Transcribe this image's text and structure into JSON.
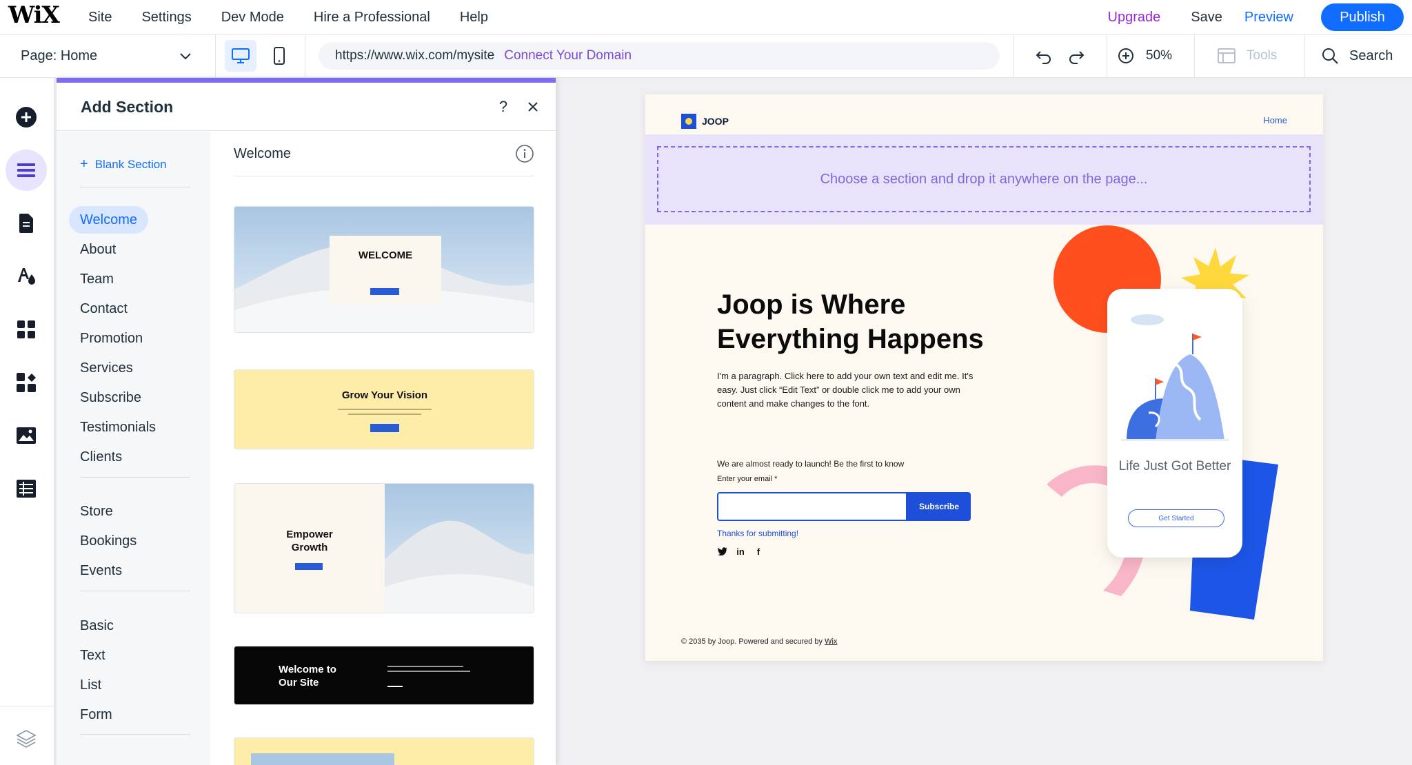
{
  "topbar": {
    "logo": "WiX",
    "menu": [
      "Site",
      "Settings",
      "Dev Mode",
      "Hire a Professional",
      "Help"
    ],
    "upgrade": "Upgrade",
    "save": "Save",
    "preview": "Preview",
    "publish": "Publish"
  },
  "bar2": {
    "page_label": "Page: Home",
    "url": "https://www.wix.com/mysite",
    "connect_domain": "Connect Your Domain",
    "zoom": "50%",
    "tools": "Tools",
    "search": "Search"
  },
  "panel": {
    "title": "Add Section",
    "help": "?",
    "blank_section": "Blank Section",
    "categories_group1": [
      "Welcome",
      "About",
      "Team",
      "Contact",
      "Promotion",
      "Services",
      "Subscribe",
      "Testimonials",
      "Clients"
    ],
    "categories_group2": [
      "Store",
      "Bookings",
      "Events"
    ],
    "categories_group3": [
      "Basic",
      "Text",
      "List",
      "Form"
    ],
    "active_category": "Welcome",
    "templates_title": "Welcome",
    "templates": [
      {
        "heading": "WELCOME"
      },
      {
        "heading": "Grow Your Vision"
      },
      {
        "heading": "Empower Growth"
      },
      {
        "heading": "Welcome to Our Site"
      }
    ]
  },
  "site": {
    "logo": "JOOP",
    "nav_home": "Home",
    "dropzone": "Choose a section and drop it anywhere on the page...",
    "hero_title": "Joop is Where Everything Happens",
    "hero_paragraph": "I'm a paragraph. Click here to add your own text and edit me. It's easy. Just click “Edit Text” or double click me to add your own content and make changes to the font.",
    "launch_text": "We are almost ready to launch! Be the first to know",
    "email_label": "Enter your email *",
    "subscribe": "Subscribe",
    "thanks": "Thanks for submitting!",
    "phone_text": "Life Just Got Better",
    "phone_button": "Get Started",
    "footer": "© 2035 by Joop. Powered and secured by",
    "footer_link": "Wix"
  },
  "colors": {
    "accent": "#116dff",
    "upgrade": "#9a27d5",
    "panel_accent": "#7f6bf3",
    "site_blue": "#1d4fd8",
    "orange": "#ff4f1f",
    "yellow": "#ffd93b",
    "pink": "#f9b6c8"
  },
  "icons": {
    "rail": [
      "add-icon",
      "sections-icon",
      "pages-icon",
      "design-icon",
      "apps-icon",
      "business-icon",
      "media-icon",
      "cms-icon",
      "layers-icon"
    ]
  }
}
